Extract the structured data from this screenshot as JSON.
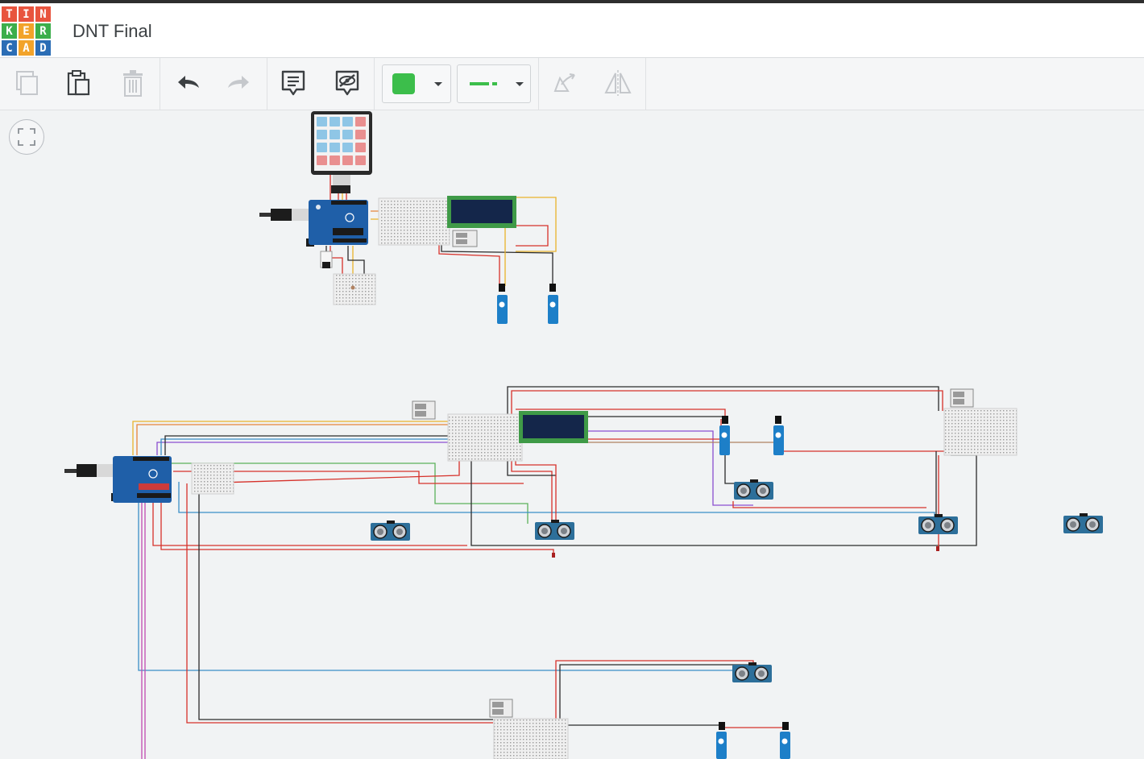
{
  "app": {
    "logo_letters": [
      "T",
      "I",
      "N",
      "K",
      "E",
      "R",
      "C",
      "A",
      "D"
    ],
    "logo_colors": [
      "#e8543e",
      "#e8543e",
      "#e8543e",
      "#3cae4b",
      "#f2a32a",
      "#3cae4b",
      "#2b6db5",
      "#f2a32a",
      "#2b6db5"
    ],
    "project_title": "DNT Final"
  },
  "toolbar": {
    "buttons": [
      {
        "name": "copy-icon",
        "state": "disabled"
      },
      {
        "name": "paste-icon",
        "state": "enabled"
      },
      {
        "name": "delete-icon",
        "state": "disabled"
      },
      {
        "name": "undo-icon",
        "state": "enabled"
      },
      {
        "name": "redo-icon",
        "state": "disabled"
      },
      {
        "name": "notes-icon",
        "state": "enabled"
      },
      {
        "name": "hide-notes-icon",
        "state": "enabled"
      },
      {
        "name": "rotate-icon",
        "state": "disabled"
      },
      {
        "name": "flip-icon",
        "state": "disabled"
      }
    ],
    "wire_color": "#3cbe4b",
    "wire_type": "straight-line"
  },
  "canvas": {
    "fit_view_icon": "fullscreen-corners-icon"
  },
  "colors": {
    "wire_red": "#d6312a",
    "wire_black": "#2b2b2b",
    "wire_yellow": "#e9b32b",
    "wire_orange": "#e5843a",
    "wire_blue": "#3a8ec6",
    "wire_green": "#5bb25a",
    "wire_purple": "#8b4ed0",
    "wire_pink": "#c24ab0",
    "wire_brown": "#b08160",
    "arduino_blue": "#1f5fa8",
    "lcd_green": "#3f9a47",
    "servo_blue": "#1d7fc8",
    "sensor_blue": "#2d6f9a"
  }
}
